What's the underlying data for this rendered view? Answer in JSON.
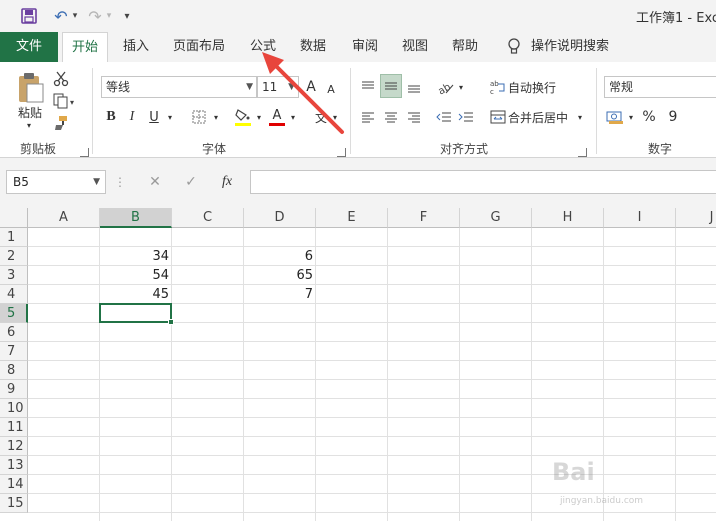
{
  "window": {
    "title": "工作簿1  -  Exc"
  },
  "quick_access": {
    "save": "save-icon",
    "undo": "↶",
    "redo": "↷",
    "customize": "▾"
  },
  "tabs": {
    "file": "文件",
    "home": "开始",
    "insert": "插入",
    "page_layout": "页面布局",
    "formulas": "公式",
    "data": "数据",
    "review": "审阅",
    "view": "视图",
    "help": "帮助",
    "tell_me": "操作说明搜索"
  },
  "clipboard": {
    "paste_label": "粘贴",
    "group_label": "剪贴板"
  },
  "font": {
    "name": "等线",
    "size": "11",
    "bold": "B",
    "italic": "I",
    "underline": "U",
    "grow": "A",
    "shrink": "A",
    "font_color": "A",
    "wen": "文",
    "group_label": "字体"
  },
  "alignment": {
    "wrap_text": "自动换行",
    "merge_center": "合并后居中",
    "group_label": "对齐方式"
  },
  "number": {
    "format": "常规",
    "percent": "%",
    "comma": "9",
    "group_label": "数字"
  },
  "formula_bar": {
    "name_box": "B5",
    "cancel": "✕",
    "enter": "✓",
    "fx": "fx",
    "value": ""
  },
  "grid": {
    "columns": [
      "A",
      "B",
      "C",
      "D",
      "E",
      "F",
      "G",
      "H",
      "I",
      "J"
    ],
    "rows": [
      "1",
      "2",
      "3",
      "4",
      "5",
      "6",
      "7",
      "8",
      "9",
      "10",
      "11",
      "12",
      "13",
      "14",
      "15"
    ],
    "selected_cell": "B5",
    "cells": {
      "B2": "34",
      "B3": "54",
      "B4": "45",
      "D2": "6",
      "D3": "65",
      "D4": "7"
    }
  },
  "colors": {
    "accent": "#217346",
    "annotation_arrow": "#e8453c"
  },
  "watermark": {
    "text": "Bai",
    "sub": "jingyan.baidu.com"
  }
}
